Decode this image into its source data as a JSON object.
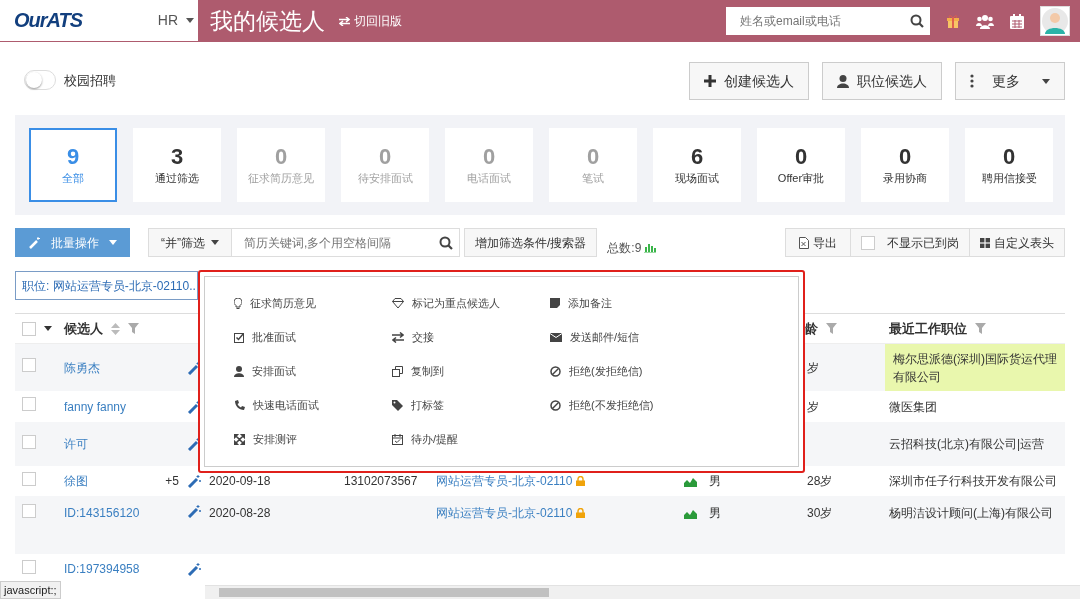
{
  "header": {
    "logo": "OurATS",
    "role_switch": "HR",
    "title": "我的候选人",
    "switch_link": "切回旧版",
    "search": {
      "placeholder": "姓名或email或电话"
    }
  },
  "campus_toggle": {
    "label": "校园招聘",
    "on": false
  },
  "actions": [
    "创建候选人",
    "职位候选人",
    "更多"
  ],
  "stages": [
    {
      "count": "9",
      "label": "全部",
      "selected": true,
      "disabled": false
    },
    {
      "count": "3",
      "label": "通过筛选",
      "selected": false,
      "disabled": false
    },
    {
      "count": "0",
      "label": "征求简历意见",
      "selected": false,
      "disabled": true
    },
    {
      "count": "0",
      "label": "待安排面试",
      "selected": false,
      "disabled": true
    },
    {
      "count": "0",
      "label": "电话面试",
      "selected": false,
      "disabled": true
    },
    {
      "count": "0",
      "label": "笔试",
      "selected": false,
      "disabled": true
    },
    {
      "count": "6",
      "label": "现场面试",
      "selected": false,
      "disabled": false
    },
    {
      "count": "0",
      "label": "Offer审批",
      "selected": false,
      "disabled": false
    },
    {
      "count": "0",
      "label": "录用协商",
      "selected": false,
      "disabled": false
    },
    {
      "count": "0",
      "label": "聘用信接受",
      "selected": false,
      "disabled": false
    }
  ],
  "toolbar": {
    "batch_button": "批量操作",
    "filter_mode": "“并”筛选",
    "keyword": {
      "placeholder": "简历关键词,多个用空格间隔"
    },
    "add_filter": "增加筛选条件/搜索器",
    "total": "总数:9",
    "export": "导出",
    "hide_onboard": {
      "label": "不显示已到岗",
      "checked": false
    },
    "custom_columns": "自定义表头"
  },
  "active_filters": [
    {
      "label": "职位: 网站运营专员-北京-02110.."
    }
  ],
  "table": {
    "select_all_checked": false,
    "columns": [
      {
        "label": "候选人",
        "sortable": true,
        "filterable": true
      },
      {
        "label": "龄",
        "sortable": false,
        "filterable": true
      },
      {
        "label": "最近工作职位",
        "sortable": false,
        "filterable": true
      }
    ],
    "rows": [
      {
        "name": "陈勇杰",
        "age": "岁",
        "company": "梅尔思派德(深圳)国际货运代理有限公司",
        "checked": false,
        "highlighted": true
      },
      {
        "name": "fanny fanny",
        "age": "岁",
        "company": "微医集团",
        "checked": false,
        "highlighted": false
      },
      {
        "name": "许可",
        "company": "云招科技(北京)有限公司|运营",
        "checked": false,
        "highlighted": false
      },
      {
        "name": "徐图",
        "extra": "+5",
        "date": "2020-09-18",
        "phone": "13102073567",
        "position": "网站运营专员-北京-02110",
        "gender": "男",
        "age": "28岁",
        "company": "深圳市任子行科技开发有限公司",
        "checked": false,
        "highlighted": false
      },
      {
        "name": "ID:143156120",
        "date": "2020-08-28",
        "position": "网站运营专员-北京-02110",
        "gender": "男",
        "age": "30岁",
        "company": "杨明洁设计顾问(上海)有限公司",
        "checked": false,
        "highlighted": false
      },
      {
        "name": "ID:197394958",
        "checked": false,
        "highlighted": false
      }
    ]
  },
  "batch_menu": {
    "columns": [
      [
        "征求简历意见",
        "批准面试",
        "安排面试",
        "快速电话面试",
        "安排测评"
      ],
      [
        "标记为重点候选人",
        "交接",
        "复制到",
        "打标签",
        "待办/提醒"
      ],
      [
        "添加备注",
        "发送邮件/短信",
        "拒绝(发拒绝信)",
        "拒绝(不发拒绝信)"
      ]
    ]
  },
  "status_tooltip": "javascript:;"
}
